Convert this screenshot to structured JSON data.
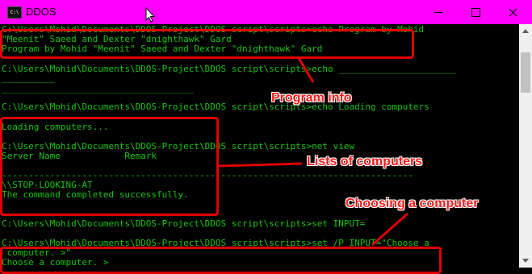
{
  "window": {
    "title": "DDOS",
    "app_icon_text": "C:\\"
  },
  "console": {
    "lines": [
      "C:\\Users\\Mohid\\Documents\\DDOS-Project\\DDOS script\\scripts>echo Program by Mohid",
      "\"Meenit\" Saeed and Dexter \"dnighthawk\" Gard",
      "Program by Mohid \"Meenit\" Saeed and Dexter \"dnighthawk\" Gard",
      "",
      "C:\\Users\\Mohid\\Documents\\DDOS-Project\\DDOS script\\scripts>echo ______________________",
      "__________",
      "____________________________________",
      "",
      "C:\\Users\\Mohid\\Documents\\DDOS-Project\\DDOS script\\scripts>echo Loading computers",
      "",
      "Loading computers...",
      "",
      "C:\\Users\\Mohid\\Documents\\DDOS-Project\\DDOS script\\scripts>net view",
      "Server Name            Remark",
      "",
      "-----------------------------------------------------------------------------",
      "\\\\STOP-LOOKING-AT",
      "The command completed successfully.",
      "",
      "",
      "C:\\Users\\Mohid\\Documents\\DDOS-Project\\DDOS script\\scripts>set INPUT=",
      "",
      "C:\\Users\\Mohid\\Documents\\DDOS-Project\\DDOS script\\scripts>set /P INPUT=\"Choose a",
      " computer. >\"",
      "Choose a computer. >"
    ]
  },
  "annotations": {
    "program_info": "Program info",
    "lists_of_computers": "Lists of computers",
    "choosing_a_computer": "Choosing a computer"
  },
  "colors": {
    "titlebar": "#ff00ff",
    "console_background": "#000000",
    "console_text": "#16c60c",
    "annotation": "#e00000"
  }
}
